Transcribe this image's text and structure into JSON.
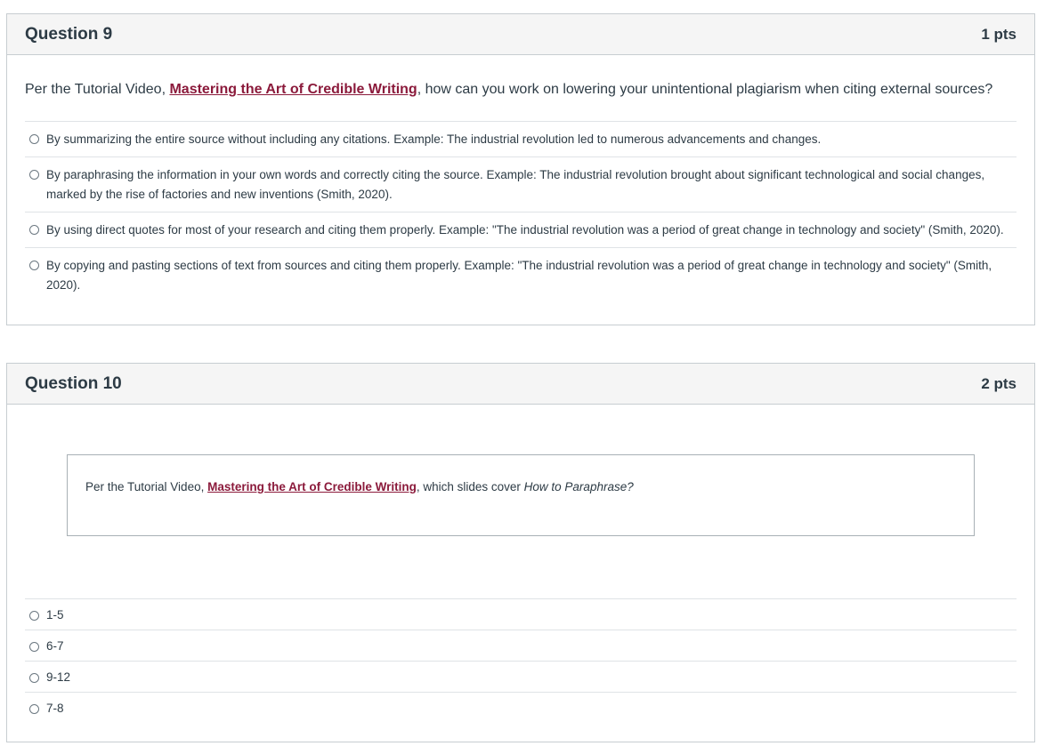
{
  "q9": {
    "title": "Question 9",
    "points": "1 pts",
    "prompt_before": "Per the Tutorial Video, ",
    "link_text": "Mastering the Art of Credible Writing",
    "prompt_after": ", how can you work on lowering your unintentional plagiarism when citing external sources?",
    "answers": [
      "By summarizing the entire source without including any citations. Example: The industrial revolution led to numerous advancements and changes.",
      "By paraphrasing the information in your own words and correctly citing the source. Example: The industrial revolution brought about significant technological and social changes, marked by the rise of factories and new inventions (Smith, 2020).",
      "By using direct quotes for most of your research and citing them properly. Example: \"The industrial revolution was a period of great change in technology and society\" (Smith, 2020).",
      "By copying and pasting sections of text from sources and citing them properly. Example: \"The industrial revolution was a period of great change in technology and society\" (Smith, 2020)."
    ]
  },
  "q10": {
    "title": "Question 10",
    "points": "2 pts",
    "prompt_before": "Per the Tutorial Video, ",
    "link_text": "Mastering the Art of Credible Writing",
    "prompt_middle": ", which slides cover ",
    "prompt_emphasis": "How to Paraphrase?",
    "answers": [
      "1-5",
      "6-7",
      "9-12",
      "7-8"
    ]
  }
}
